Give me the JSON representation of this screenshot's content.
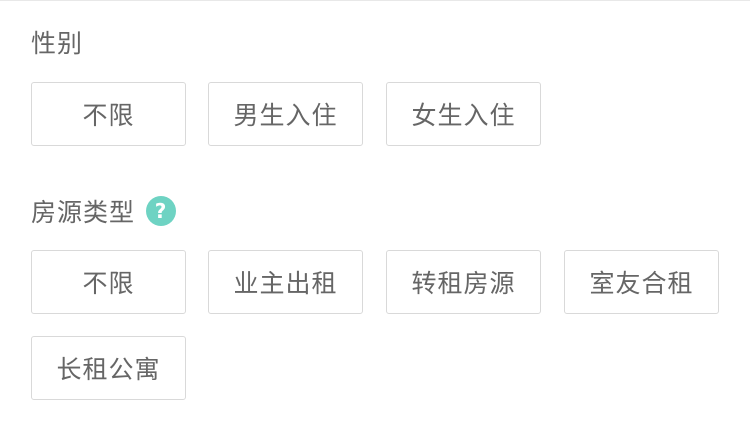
{
  "gender": {
    "title": "性别",
    "options": [
      "不限",
      "男生入住",
      "女生入住"
    ]
  },
  "housing_type": {
    "title": "房源类型",
    "help_icon": "question-mark-icon",
    "help_glyph": "?",
    "options": [
      "不限",
      "业主出租",
      "转租房源",
      "室友合租",
      "长租公寓"
    ]
  },
  "colors": {
    "help_icon_bg": "#6ed3c3",
    "text": "#666666",
    "chip_border": "#d9d9d9"
  }
}
